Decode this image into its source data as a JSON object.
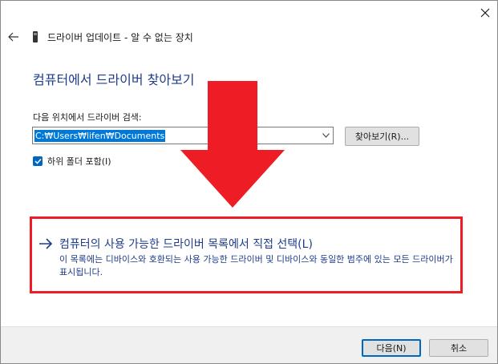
{
  "window": {
    "title": "드라이버 업데이트 - 알 수 없는 장치"
  },
  "page": {
    "heading": "컴퓨터에서 드라이버 찾아보기",
    "search_label": "다음 위치에서 드라이버 검색:",
    "path_value": "C:₩Users₩lifen₩Documents",
    "browse_label": "찾아보기(R)...",
    "include_subfolders_label": "하위 폴더 포함(I)",
    "include_subfolders_checked": true
  },
  "option": {
    "title": "컴퓨터의 사용 가능한 드라이버 목록에서 직접 선택(L)",
    "description": "이 목록에는 디바이스와 호환되는 사용 가능한 드라이버 및 디바이스와 동일한 범주에 있는 모든 드라이버가 표시됩니다."
  },
  "footer": {
    "next_label": "다음(N)",
    "cancel_label": "취소"
  },
  "colors": {
    "accent": "#0067c0",
    "heading": "#1f3c8a",
    "annotation_red": "#ee1c25"
  },
  "icons": [
    "close-icon",
    "back-arrow-icon",
    "device-icon",
    "chevron-down-icon",
    "checkmark-icon",
    "right-arrow-icon",
    "annotation-arrow"
  ]
}
